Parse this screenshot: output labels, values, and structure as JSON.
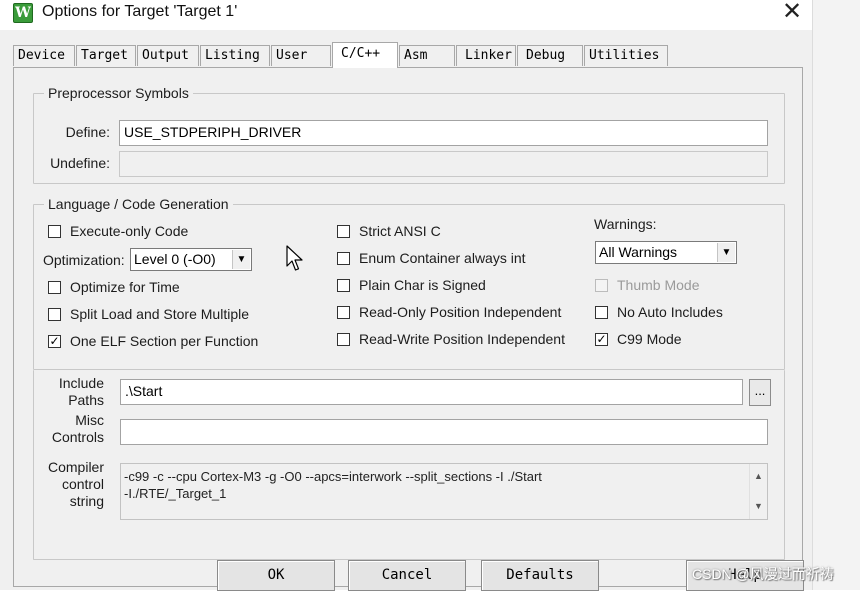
{
  "window": {
    "title": "Options for Target 'Target 1'",
    "icon_name": "keil-uvision-icon",
    "close_glyph": "✕"
  },
  "tabs": [
    {
      "label": "Device"
    },
    {
      "label": "Target"
    },
    {
      "label": "Output"
    },
    {
      "label": "Listing"
    },
    {
      "label": "User"
    },
    {
      "label": "C/C++",
      "active": true
    },
    {
      "label": "Asm"
    },
    {
      "label": "Linker"
    },
    {
      "label": "Debug"
    },
    {
      "label": "Utilities"
    }
  ],
  "preprocessor": {
    "group_title": "Preprocessor Symbols",
    "define_label": "Define:",
    "define_value": "USE_STDPERIPH_DRIVER",
    "undefine_label": "Undefine:",
    "undefine_value": ""
  },
  "codegen": {
    "group_title": "Language / Code Generation",
    "optimization_label": "Optimization:",
    "optimization_value": "Level 0 (-O0)",
    "warnings_label": "Warnings:",
    "warnings_value": "All Warnings",
    "checkboxes": {
      "execute_only": {
        "label": "Execute-only Code",
        "checked": false
      },
      "optimize_time": {
        "label": "Optimize for Time",
        "checked": false
      },
      "split_load": {
        "label": "Split Load and Store Multiple",
        "checked": false
      },
      "one_elf": {
        "label": "One ELF Section per Function",
        "checked": true
      },
      "strict_ansi": {
        "label": "Strict ANSI C",
        "checked": false
      },
      "enum_int": {
        "label": "Enum Container always int",
        "checked": false
      },
      "plain_char": {
        "label": "Plain Char is Signed",
        "checked": false
      },
      "ro_pi": {
        "label": "Read-Only Position Independent",
        "checked": false
      },
      "rw_pi": {
        "label": "Read-Write Position Independent",
        "checked": false
      },
      "thumb_mode": {
        "label": "Thumb Mode",
        "checked": false,
        "disabled": true
      },
      "no_auto_includes": {
        "label": "No Auto Includes",
        "checked": false
      },
      "c99_mode": {
        "label": "C99 Mode",
        "checked": true
      }
    }
  },
  "paths": {
    "include_label_1": "Include",
    "include_label_2": "Paths",
    "include_value": ".\\Start",
    "browse_label": "...",
    "misc_label_1": "Misc",
    "misc_label_2": "Controls",
    "misc_value": "",
    "compiler_label_1": "Compiler",
    "compiler_label_2": "control",
    "compiler_label_3": "string",
    "compiler_line_1": "-c99 -c --cpu Cortex-M3 -g -O0 --apcs=interwork --split_sections -I ./Start",
    "compiler_line_2": "-I./RTE/_Target_1"
  },
  "buttons": {
    "ok": "OK",
    "cancel": "Cancel",
    "defaults": "Defaults",
    "help": "Help"
  },
  "watermark": "CSDN @风漫过而祈祷",
  "glyphs": {
    "check": "✓",
    "dropdown": "▼",
    "scroll_up": "▲",
    "scroll_down": "▼"
  }
}
